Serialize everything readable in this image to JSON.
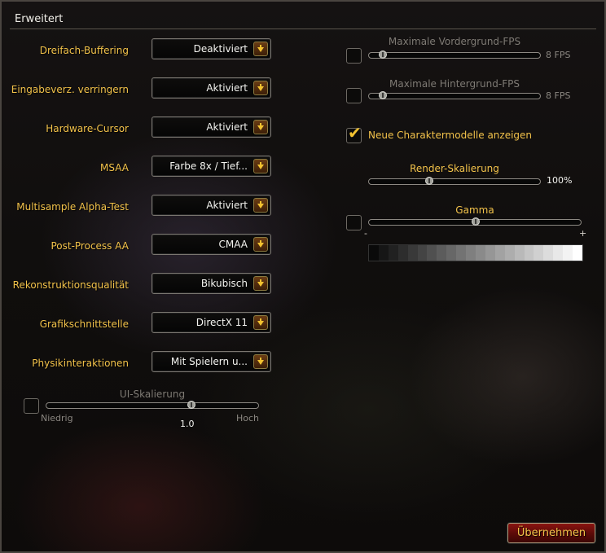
{
  "title": "Erweitert",
  "options": [
    {
      "label": "Dreifach-Buffering",
      "value": "Deaktiviert"
    },
    {
      "label": "Eingabeverz. verringern",
      "value": "Aktiviert"
    },
    {
      "label": "Hardware-Cursor",
      "value": "Aktiviert"
    },
    {
      "label": "MSAA",
      "value": "Farbe 8x / Tief..."
    },
    {
      "label": "Multisample Alpha-Test",
      "value": "Aktiviert"
    },
    {
      "label": "Post-Process AA",
      "value": "CMAA"
    },
    {
      "label": "Rekonstruktionsqualität",
      "value": "Bikubisch"
    },
    {
      "label": "Grafikschnittstelle",
      "value": "DirectX 11"
    },
    {
      "label": "Physikinteraktionen",
      "value": "Mit Spielern u..."
    }
  ],
  "ui_scale": {
    "label": "UI-Skalierung",
    "min_label": "Niedrig",
    "max_label": "Hoch",
    "value": "1.0",
    "checked": false,
    "position": 0.68
  },
  "fg_fps": {
    "label": "Maximale Vordergrund-FPS",
    "value": "8 FPS",
    "checked": false,
    "position": 0.08
  },
  "bg_fps": {
    "label": "Maximale Hintergrund-FPS",
    "value": "8 FPS",
    "checked": false,
    "position": 0.08
  },
  "char_models": {
    "label": "Neue Charaktermodelle anzeigen",
    "checked": true
  },
  "render_scale": {
    "label": "Render-Skalierung",
    "value": "100%",
    "position": 0.35
  },
  "gamma": {
    "label": "Gamma",
    "minus": "-",
    "plus": "+",
    "checked": false,
    "position": 0.5
  },
  "apply_label": "Übernehmen",
  "colors": {
    "label_gold": "#f2c24a",
    "disabled": "#7e7a74",
    "button_red": "#8a1410",
    "checkmark": "#f2c230"
  }
}
